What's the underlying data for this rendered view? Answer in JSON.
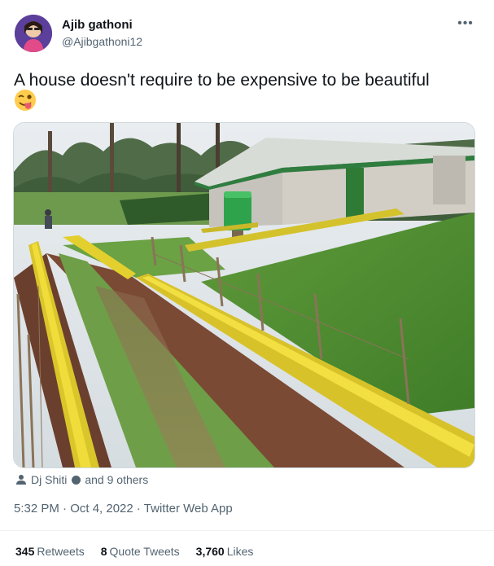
{
  "user": {
    "name": "Ajib gathoni",
    "handle": "@Ajibgathoni12"
  },
  "tweet": {
    "text": "A house doesn't require to be expensive to be beautiful",
    "emoji_icon": "winking-face-with-tongue-icon"
  },
  "social_context": {
    "name": "Dj Shiti",
    "suffix": "and 9 others"
  },
  "meta": {
    "time_line": "5:32 PM · Oct 4, 2022 · Twitter Web App"
  },
  "stats": {
    "retweets_count": "345",
    "retweets_label": "Retweets",
    "quote_count": "8",
    "quote_label": "Quote Tweets",
    "likes_count": "3,760",
    "likes_label": "Likes"
  },
  "colors": {
    "secondary_text": "#536471",
    "primary_text": "#0f1419"
  }
}
